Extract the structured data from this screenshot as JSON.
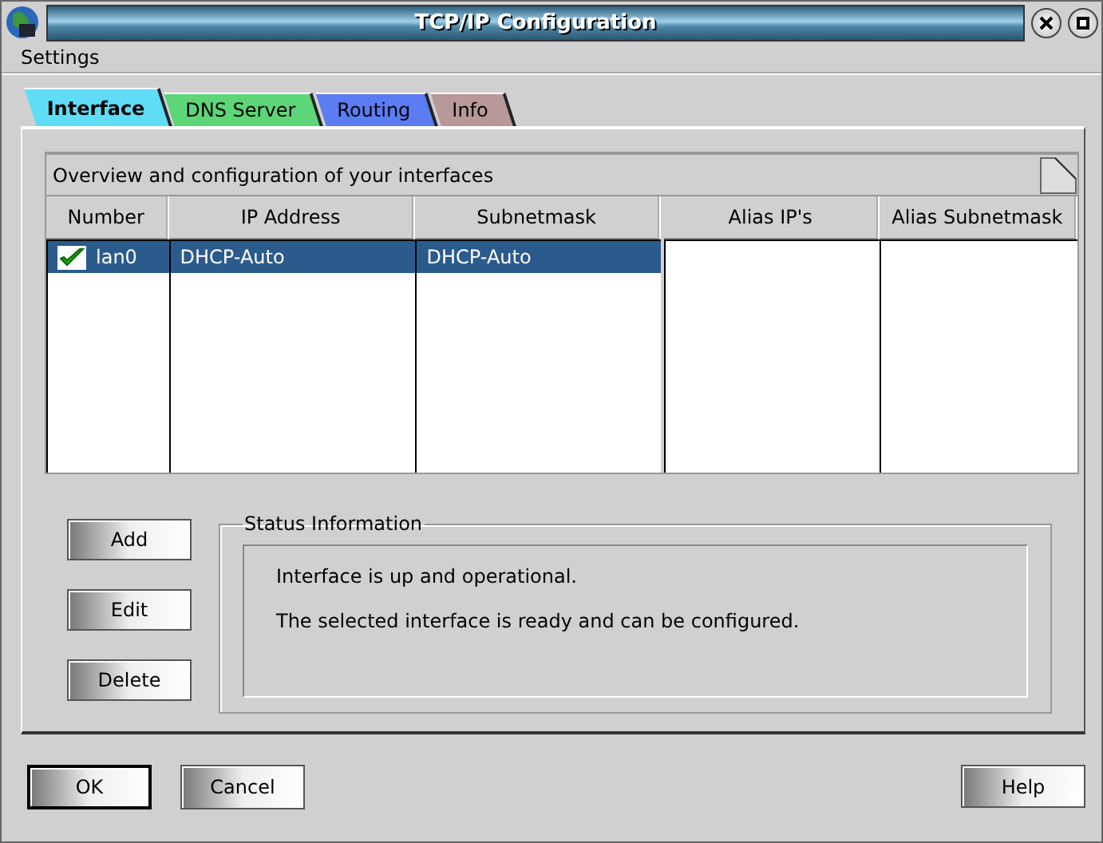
{
  "window": {
    "title": "TCP/IP Configuration"
  },
  "menu": [
    "Settings"
  ],
  "tabs": [
    {
      "label": "Interface",
      "selected": true,
      "color": "#5fdcf6"
    },
    {
      "label": "DNS Server",
      "selected": false,
      "color": "#5cd676"
    },
    {
      "label": "Routing",
      "selected": false,
      "color": "#5b7cf2"
    },
    {
      "label": "Info",
      "selected": false,
      "color": "#b89898"
    }
  ],
  "panel": {
    "title": "Overview and configuration of your interfaces",
    "table": {
      "columns": [
        "Number",
        "IP Address",
        "Subnetmask"
      ],
      "rows": [
        {
          "enabled": true,
          "selected": true,
          "cells": [
            "lan0",
            "DHCP-Auto",
            "DHCP-Auto"
          ]
        }
      ]
    },
    "alias_columns": [
      "Alias IP's",
      "Alias Subnetmask"
    ]
  },
  "actions": [
    "Add",
    "Edit",
    "Delete"
  ],
  "status": {
    "title": "Status Information",
    "lines": [
      "Interface is up and operational.",
      "The selected interface is ready and can be configured."
    ]
  },
  "buttons": [
    {
      "label": "OK",
      "default": true
    },
    {
      "label": "Cancel",
      "default": false
    }
  ],
  "help_button": "Help"
}
